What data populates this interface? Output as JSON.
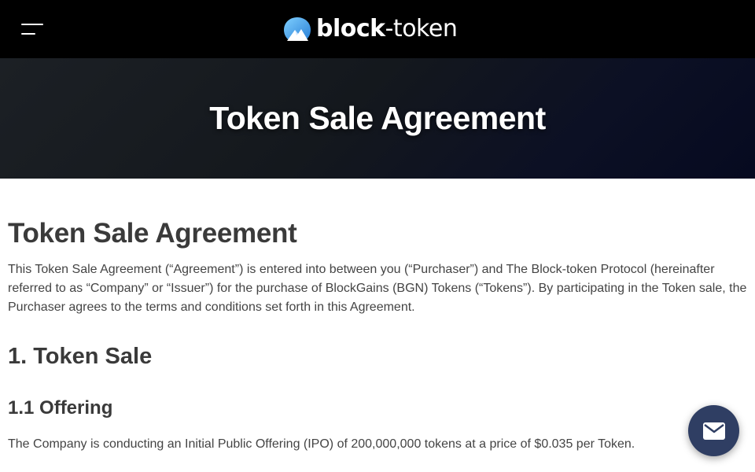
{
  "header": {
    "logo_bold": "block",
    "logo_light": "-token",
    "menu_icon": "hamburger-menu-icon",
    "logo_icon": "mountain-logo-icon"
  },
  "hero": {
    "title": "Token Sale Agreement"
  },
  "article": {
    "heading": "Token Sale Agreement",
    "intro": "This Token Sale Agreement (“Agreement”) is entered into between you (“Purchaser”) and The Block-token Protocol (hereinafter referred to as “Company” or “Issuer”) for the purchase of BlockGains (BGN) Tokens (“Tokens”). By participating in the Token sale, the Purchaser agrees to the terms and conditions set forth in this Agreement.",
    "section_heading": "1. Token Sale",
    "subsection_heading": "1.1 Offering",
    "offering_text": "The Company is conducting an Initial Public Offering (IPO) of 200,000,000 tokens at a price of $0.035 per Token."
  },
  "chat_widget": {
    "icon": "envelope-icon"
  },
  "colors": {
    "topbar": "#000000",
    "hero_dark": "#14181d",
    "hero_navy": "#060a20",
    "text": "#3a3a3a",
    "chat_button": "#2f3e63"
  }
}
